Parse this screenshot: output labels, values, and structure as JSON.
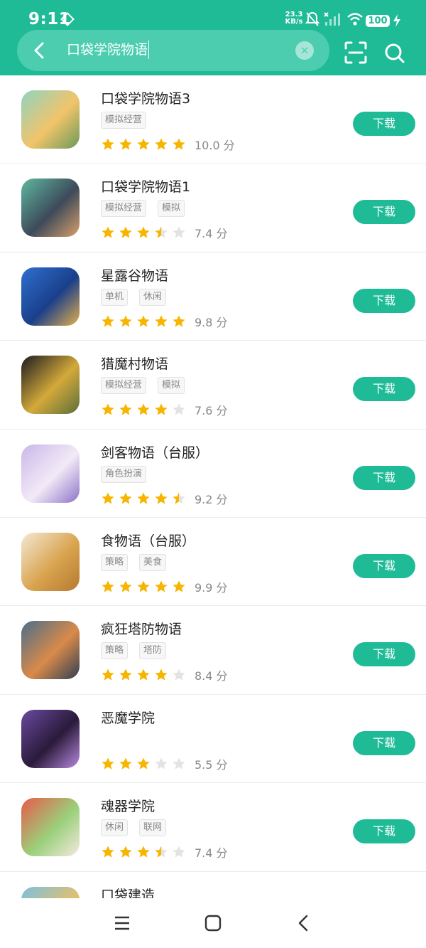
{
  "status": {
    "time": "9:11",
    "net_speed_value": "23.3",
    "net_speed_unit": "KB/s",
    "battery": "100"
  },
  "search": {
    "query": "口袋学院物语",
    "clear_glyph": "×"
  },
  "apps": [
    {
      "name": "口袋学院物语3",
      "tags": [
        "模拟经营"
      ],
      "stars": 5,
      "score": "10.0 分",
      "button": "下载",
      "icon_colors": [
        "#8fd4c0",
        "#f2c46b",
        "#6a9a5a"
      ]
    },
    {
      "name": "口袋学院物语1",
      "tags": [
        "模拟经营",
        "模拟"
      ],
      "stars": 3.5,
      "score": "7.4 分",
      "button": "下载",
      "icon_colors": [
        "#5fb8a0",
        "#3d4a5a",
        "#d9a06a"
      ]
    },
    {
      "name": "星露谷物语",
      "tags": [
        "单机",
        "休闲"
      ],
      "stars": 5,
      "score": "9.8 分",
      "button": "下载",
      "icon_colors": [
        "#2f6fd0",
        "#1a3f8a",
        "#e6b04a"
      ]
    },
    {
      "name": "猎魔村物语",
      "tags": [
        "模拟经营",
        "模拟"
      ],
      "stars": 4,
      "score": "7.6 分",
      "button": "下载",
      "icon_colors": [
        "#1a1a20",
        "#d4a93a",
        "#5a6e3a"
      ]
    },
    {
      "name": "剑客物语（台服）",
      "tags": [
        "角色扮演"
      ],
      "stars": 4.5,
      "score": "9.2 分",
      "button": "下载",
      "icon_colors": [
        "#c9b7e8",
        "#f2eaf7",
        "#8b72c7"
      ]
    },
    {
      "name": "食物语（台服）",
      "tags": [
        "策略",
        "美食"
      ],
      "stars": 5,
      "score": "9.9 分",
      "button": "下载",
      "icon_colors": [
        "#f4e8d4",
        "#d9a450",
        "#b57a30"
      ]
    },
    {
      "name": "疯狂塔防物语",
      "tags": [
        "策略",
        "塔防"
      ],
      "stars": 4,
      "score": "8.4 分",
      "button": "下载",
      "icon_colors": [
        "#4a6e8a",
        "#d98a4a",
        "#2e3e52"
      ]
    },
    {
      "name": "恶魔学院",
      "tags": [],
      "stars": 3,
      "score": "5.5 分",
      "button": "下载",
      "icon_colors": [
        "#6a4aa0",
        "#2a1a3a",
        "#b98ae0"
      ]
    },
    {
      "name": "魂器学院",
      "tags": [
        "休闲",
        "联网"
      ],
      "stars": 3.5,
      "score": "7.4 分",
      "button": "下载",
      "icon_colors": [
        "#e85a4a",
        "#9ad07a",
        "#f4e8e0"
      ]
    },
    {
      "name": "口袋建造",
      "tags": [],
      "stars": 0,
      "score": "",
      "button": "",
      "icon_colors": [
        "#7ac0e0",
        "#e0c070",
        "#5a9a50"
      ]
    }
  ],
  "colors": {
    "accent": "#1fbb97",
    "star_on": "#f7b500",
    "star_off": "#e3e3e3"
  }
}
